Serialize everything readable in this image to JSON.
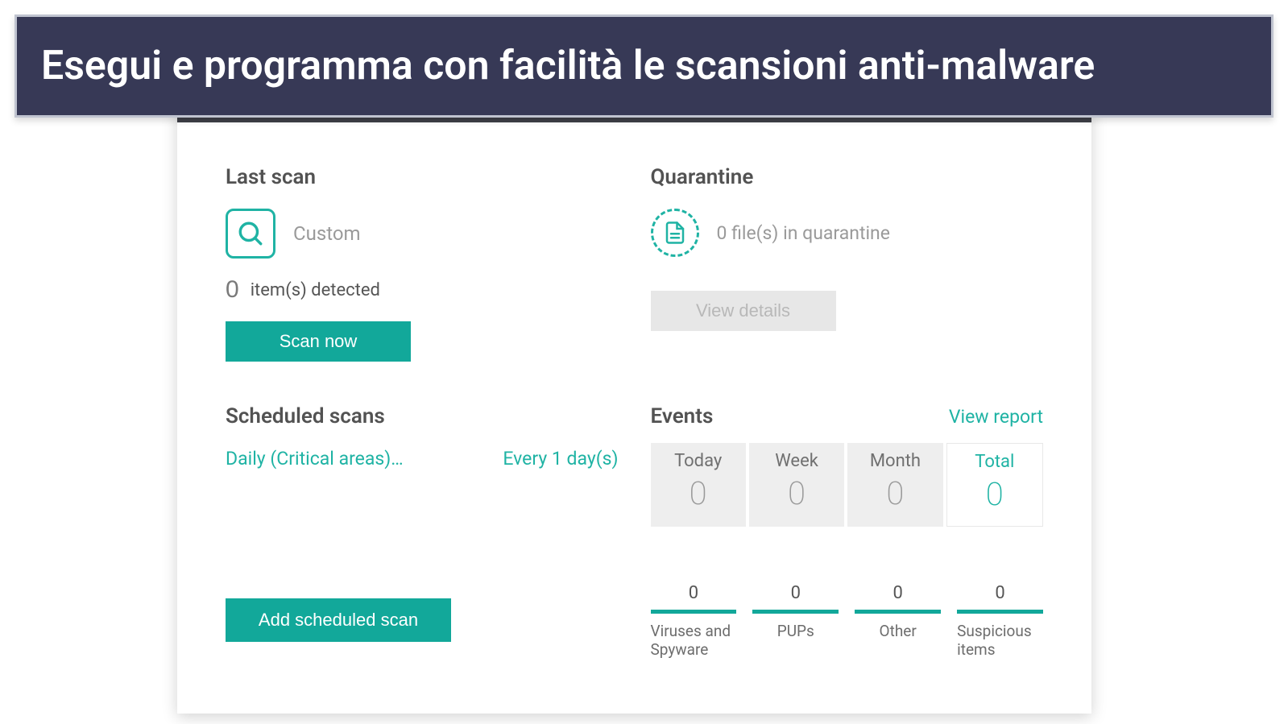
{
  "banner": {
    "title": "Esegui e programma con facilità le scansioni anti-malware"
  },
  "lastScan": {
    "title": "Last scan",
    "typeLabel": "Custom",
    "detectedCount": "0",
    "detectedText": "item(s) detected",
    "scanNow": "Scan now"
  },
  "quarantine": {
    "title": "Quarantine",
    "summary": "0 file(s) in quarantine",
    "viewDetails": "View details"
  },
  "scheduled": {
    "title": "Scheduled scans",
    "item": {
      "name": "Daily (Critical areas)…",
      "frequency": "Every 1 day(s)"
    },
    "addButton": "Add scheduled scan"
  },
  "events": {
    "title": "Events",
    "viewReport": "View report",
    "tabs": {
      "today": {
        "label": "Today",
        "value": "0"
      },
      "week": {
        "label": "Week",
        "value": "0"
      },
      "month": {
        "label": "Month",
        "value": "0"
      },
      "total": {
        "label": "Total",
        "value": "0"
      }
    },
    "categories": {
      "viruses": {
        "count": "0",
        "label": "Viruses and Spyware"
      },
      "pups": {
        "count": "0",
        "label": "PUPs"
      },
      "other": {
        "count": "0",
        "label": "Other"
      },
      "suspicious": {
        "count": "0",
        "label": "Suspicious items"
      }
    }
  },
  "colors": {
    "accent": "#12a89a",
    "bannerBg": "#373956"
  }
}
